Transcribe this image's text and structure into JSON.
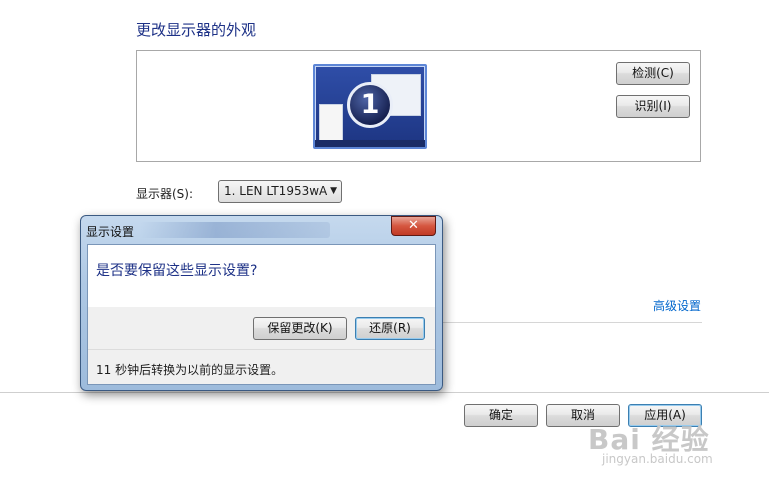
{
  "page": {
    "title": "更改显示器的外观",
    "detect_label": "检测(C)",
    "identify_label": "识别(I)",
    "monitor_number": "1",
    "display_label": "显示器(S):",
    "display_value": "1. LEN LT1953wA",
    "advanced_link": "高级设置",
    "ok_label": "确定",
    "cancel_label": "取消",
    "apply_label": "应用(A)"
  },
  "dialog": {
    "title": "显示设置",
    "close_glyph": "✕",
    "message": "是否要保留这些显示设置?",
    "keep_label": "保留更改(K)",
    "revert_label": "还原(R)",
    "countdown_text": "11 秒钟后转换为以前的显示设置。"
  },
  "watermark": {
    "logo": "Bai 经验",
    "url": "jingyan.baidu.com"
  },
  "colors": {
    "heading_blue": "#1e3287",
    "link_blue": "#0066cc",
    "dialog_frame": "#aec8e4",
    "close_red": "#c03a25"
  },
  "icons": {
    "close": "close-icon",
    "dropdown": "chevron-down-icon"
  }
}
